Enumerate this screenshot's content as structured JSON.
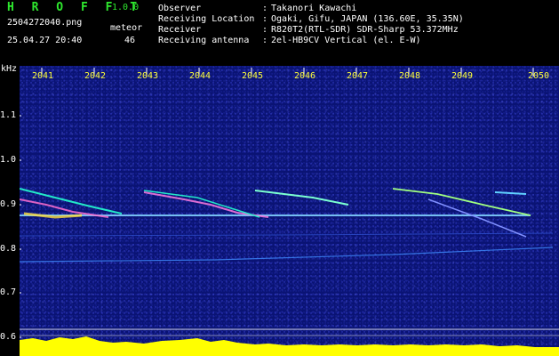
{
  "app": {
    "title": "H R O F F T",
    "version": "1.0.0",
    "filename": "2504272040.png",
    "datetime": "25.04.27 20:40",
    "counter_label": "meteor",
    "counter_value": "46"
  },
  "meta": [
    {
      "key": "Observer",
      "value": "Takanori Kawachi"
    },
    {
      "key": "Receiving Location",
      "value": "Ogaki, Gifu, JAPAN (136.60E, 35.35N)"
    },
    {
      "key": "Receiver",
      "value": "R820T2(RTL-SDR) SDR-Sharp 53.372MHz"
    },
    {
      "key": "Receiving antenna",
      "value": "2el-HB9CV Vertical (el. E-W)"
    }
  ],
  "axis": {
    "unit": "kHz",
    "y_ticks": [
      "1.1",
      "1.0",
      "0.9",
      "0.8",
      "0.7",
      "0.6"
    ],
    "x_ticks": [
      "2041",
      "2042",
      "2043",
      "2044",
      "2045",
      "2046",
      "2047",
      "2048",
      "2049",
      "2050"
    ]
  },
  "colors": {
    "background": "#0a1374",
    "tick_text": "#ffff3a",
    "title": "#2ee82e",
    "signal_bar": "#ffff00",
    "signal_bar_base": "#00c8ff"
  }
}
